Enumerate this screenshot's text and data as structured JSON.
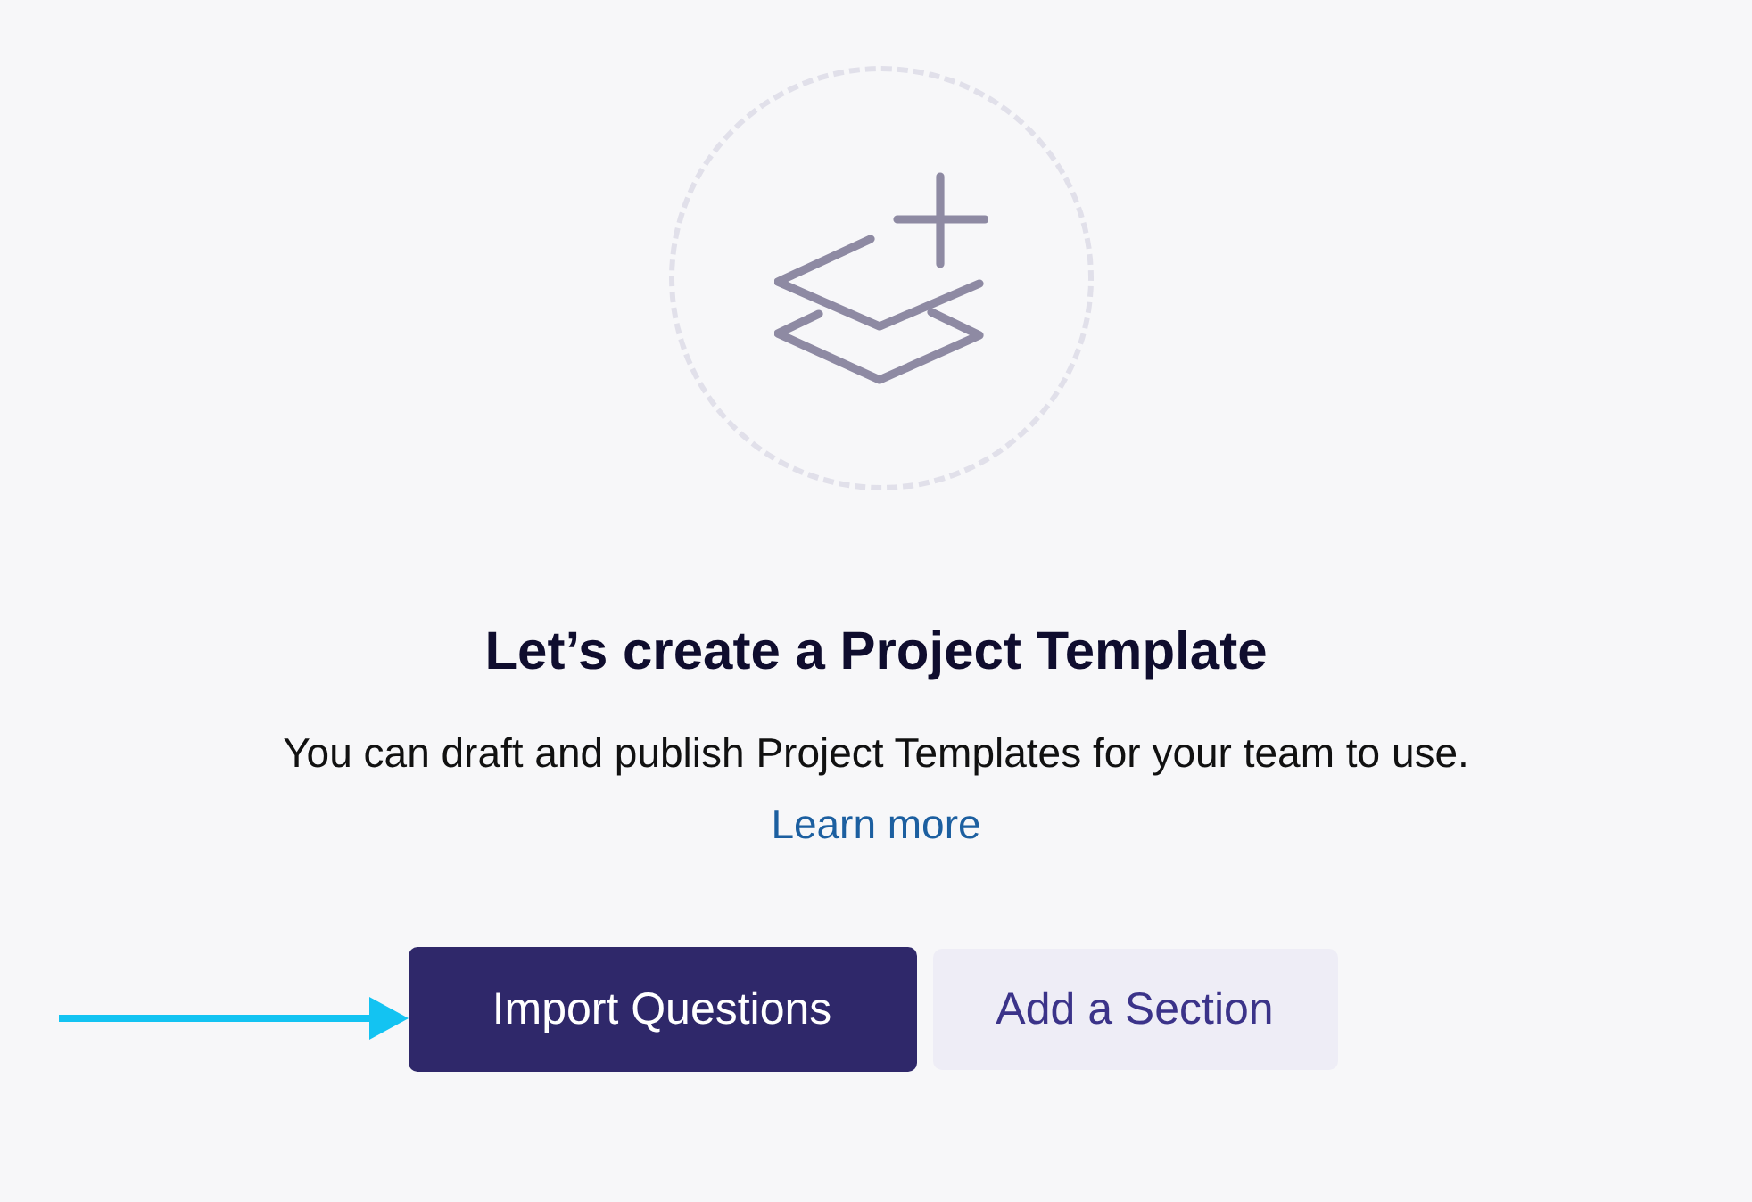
{
  "title": "Let’s create a Project Template",
  "description": "You can draft and publish Project Templates for your team to use.",
  "link": "Learn more",
  "buttons": [
    {
      "label": "Import Questions",
      "kind": "primary"
    },
    {
      "label": "Add a Section",
      "kind": "secondary"
    }
  ]
}
